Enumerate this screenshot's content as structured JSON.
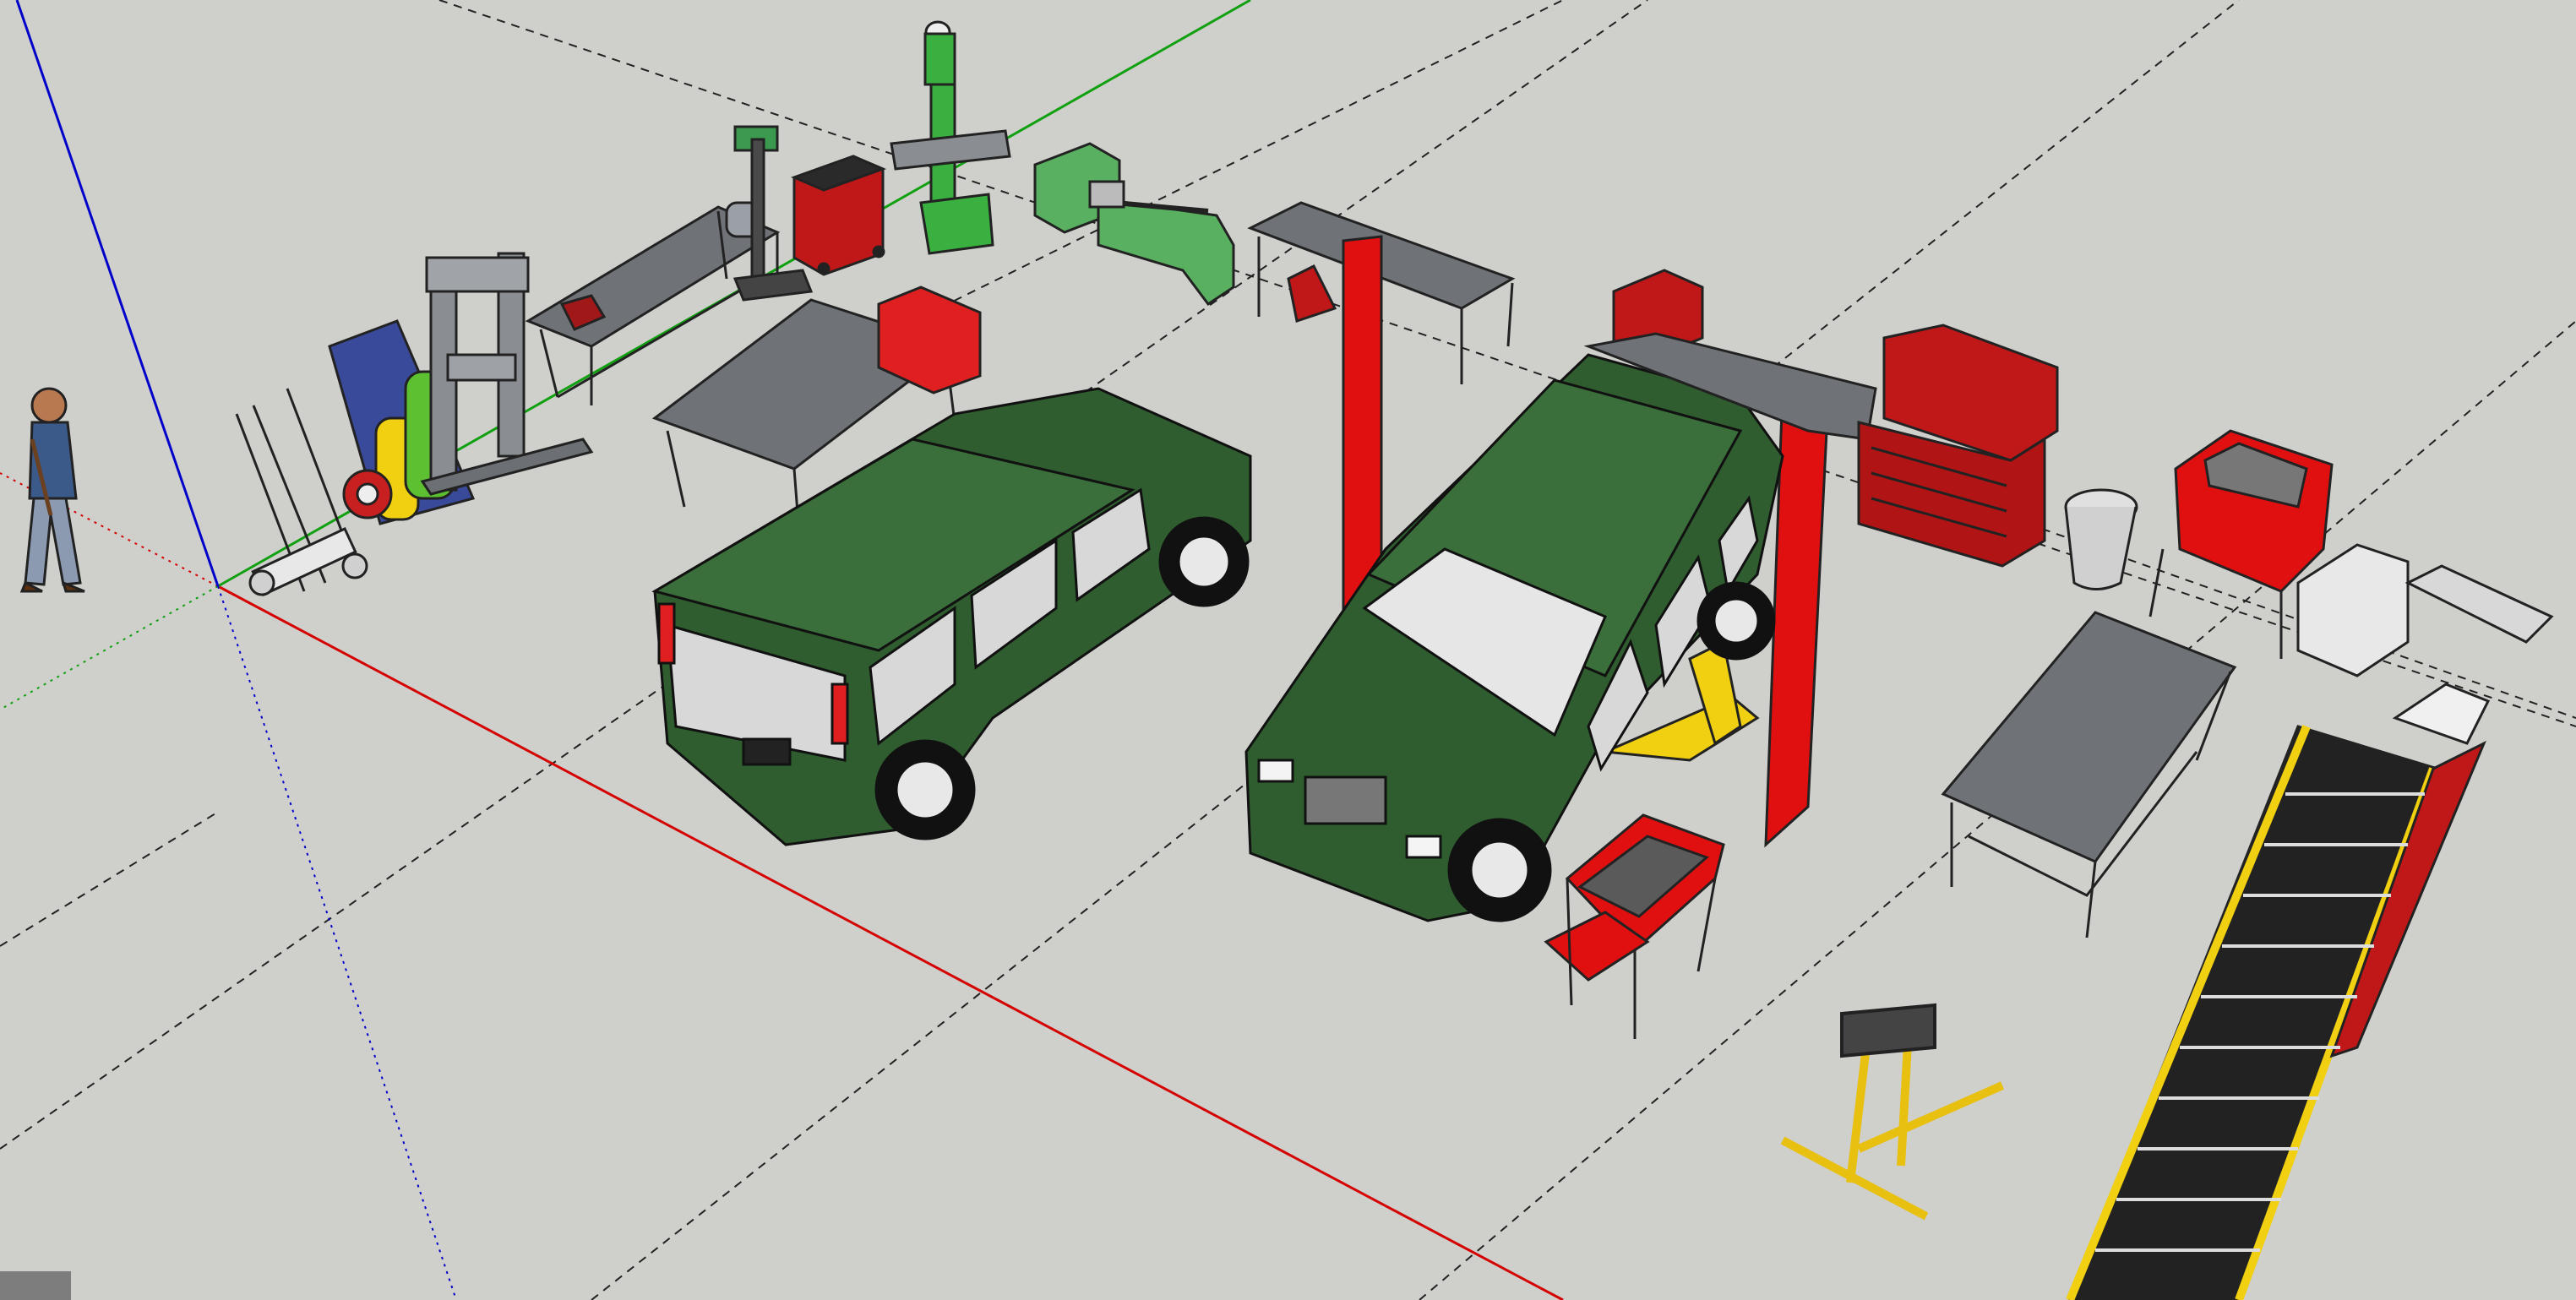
{
  "app": {
    "name": "",
    "view": "Iso perspective"
  },
  "colors": {
    "ground": "#cfcfcc",
    "axis_red": "#d40000",
    "axis_green": "#10a010",
    "axis_blue": "#0000c8",
    "car_body": "#2f5d2f",
    "lift_red": "#e01010",
    "tool_red": "#c01818",
    "steel_gray": "#6f7377",
    "yellow": "#f0d010"
  },
  "scene_objects": [
    {
      "name": "person-figure",
      "icon": "person-icon"
    },
    {
      "name": "hand-truck",
      "icon": "hand-truck-icon"
    },
    {
      "name": "gas-cylinders-cart",
      "icon": "gas-cylinder-icon"
    },
    {
      "name": "hydraulic-press",
      "icon": "press-icon"
    },
    {
      "name": "workbench",
      "icon": "workbench-icon"
    },
    {
      "name": "drill-press",
      "icon": "drill-icon"
    },
    {
      "name": "tool-cabinet",
      "icon": "cabinet-icon"
    },
    {
      "name": "milling-machine",
      "icon": "mill-icon"
    },
    {
      "name": "lathe",
      "icon": "lathe-icon"
    },
    {
      "name": "green-car",
      "icon": "car-icon"
    },
    {
      "name": "two-post-lift",
      "icon": "lift-icon"
    },
    {
      "name": "tool-chest",
      "icon": "toolchest-icon"
    },
    {
      "name": "trash-can",
      "icon": "trash-icon"
    },
    {
      "name": "sandblast-cabinet",
      "icon": "sandblast-icon"
    },
    {
      "name": "parts-washer",
      "icon": "sink-icon"
    },
    {
      "name": "welding-table",
      "icon": "table-icon"
    },
    {
      "name": "tool-cart",
      "icon": "cart-icon"
    },
    {
      "name": "engine-stand",
      "icon": "engine-stand-icon"
    },
    {
      "name": "staircase",
      "icon": "stairs-icon"
    }
  ]
}
